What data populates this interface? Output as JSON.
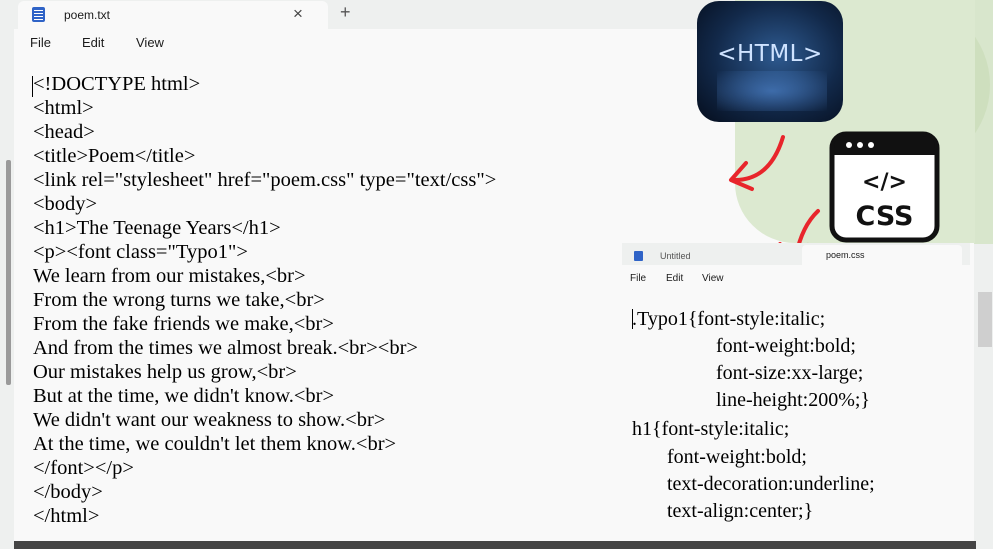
{
  "main": {
    "tab_title": "poem.txt",
    "tab_close": "×",
    "tab_new": "+",
    "menu": [
      "File",
      "Edit",
      "View"
    ],
    "lines": [
      "<!DOCTYPE html>",
      "<html>",
      "<head>",
      "<title>Poem</title>",
      "<link rel=\"stylesheet\" href=\"poem.css\" type=\"text/css\">",
      "<body>",
      "<h1>The Teenage Years</h1>",
      "<p><font class=\"Typo1\">",
      "We learn from our mistakes,<br>",
      "From the wrong turns we take,<br>",
      "From the fake friends we make,<br>",
      "And from the times we almost break.<br><br>",
      "Our mistakes help us grow,<br>",
      "But at the time, we didn't know.<br>",
      "We didn't want our weakness to show.<br>",
      "At the time, we couldn't let them know.<br>",
      "</font></p>",
      "</body>",
      "</html>"
    ]
  },
  "css_window": {
    "tab_untitled": "Untitled",
    "tab_active": "poem.css",
    "menu": [
      "File",
      "Edit",
      "View"
    ],
    "lines": [
      ".Typo1{font-style:italic;",
      "font-weight:bold;",
      "font-size:xx-large;",
      "line-height:200%;}",
      "h1{font-style:italic;",
      "font-weight:bold;",
      "text-decoration:underline;",
      "text-align:center;}"
    ]
  },
  "badges": {
    "html_label": "<HTML>",
    "css_label": "CSS",
    "css_tag": "</>"
  },
  "colors": {
    "arrow": "#e8252b",
    "notepad_icon": "#2f63c7",
    "editor_bg": "#f9f9f9"
  }
}
